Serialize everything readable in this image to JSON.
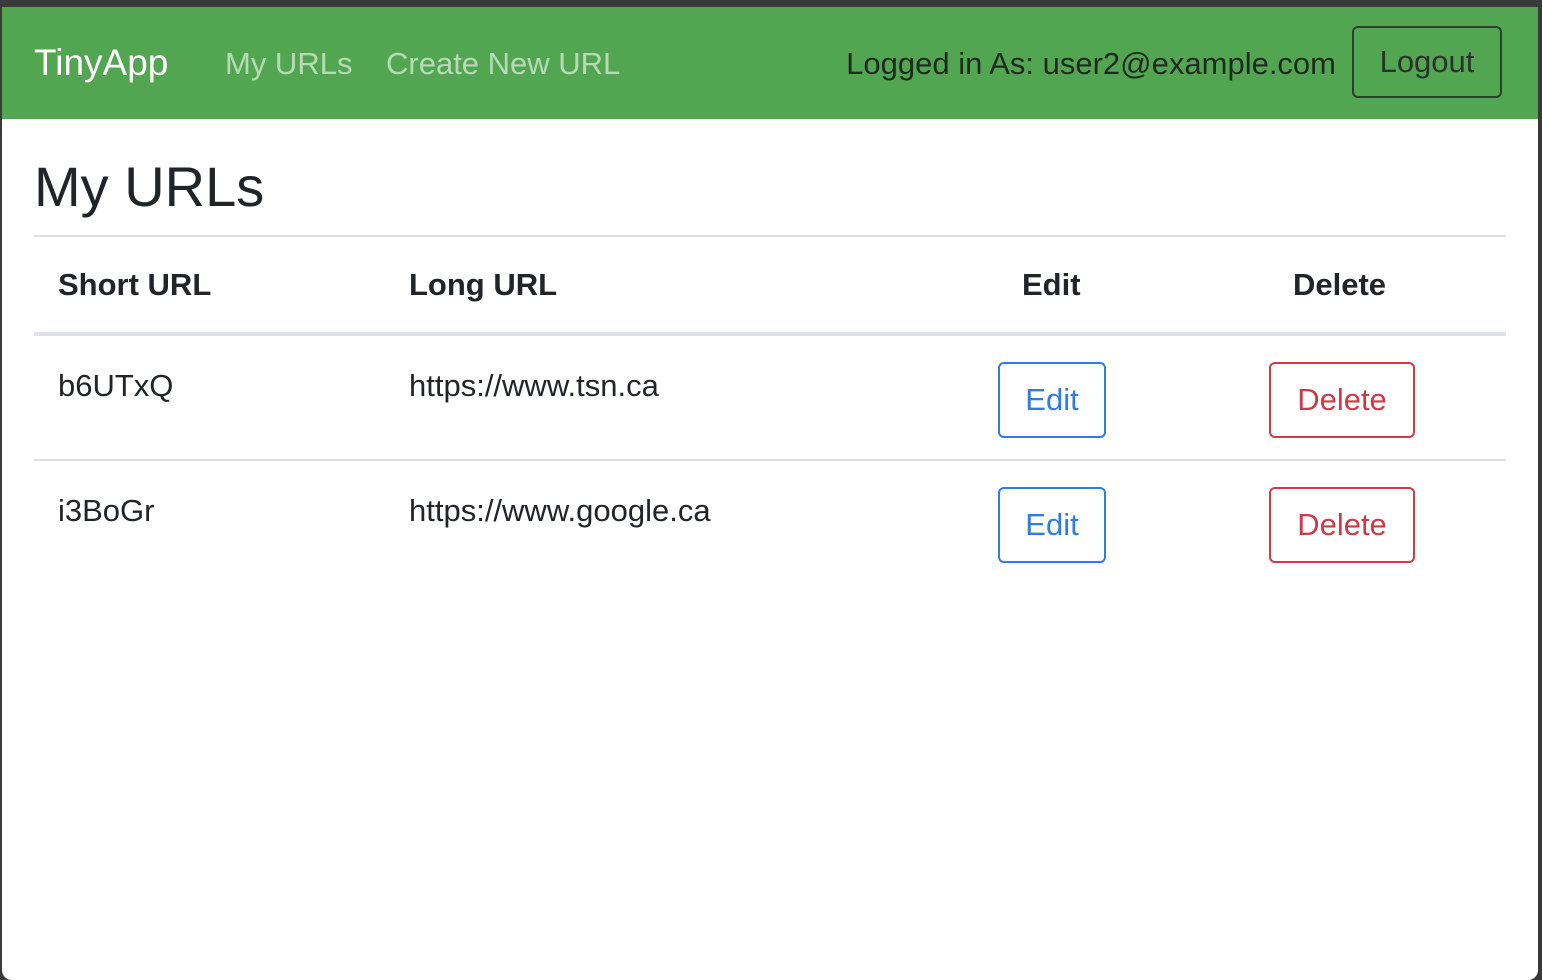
{
  "navbar": {
    "brand": "TinyApp",
    "links": [
      "My URLs",
      "Create New URL"
    ],
    "logged_in_text": "Logged in As: user2@example.com",
    "logout_label": "Logout",
    "background_color": "#53a651"
  },
  "main": {
    "title": "My URLs",
    "table": {
      "headers": [
        "Short URL",
        "Long URL",
        "Edit",
        "Delete"
      ],
      "rows": [
        {
          "short_url": "b6UTxQ",
          "long_url": "https://www.tsn.ca",
          "edit_label": "Edit",
          "delete_label": "Delete"
        },
        {
          "short_url": "i3BoGr",
          "long_url": "https://www.google.ca",
          "edit_label": "Edit",
          "delete_label": "Delete"
        }
      ]
    }
  },
  "colors": {
    "edit": "#2f7de1",
    "delete": "#cc3b47"
  }
}
